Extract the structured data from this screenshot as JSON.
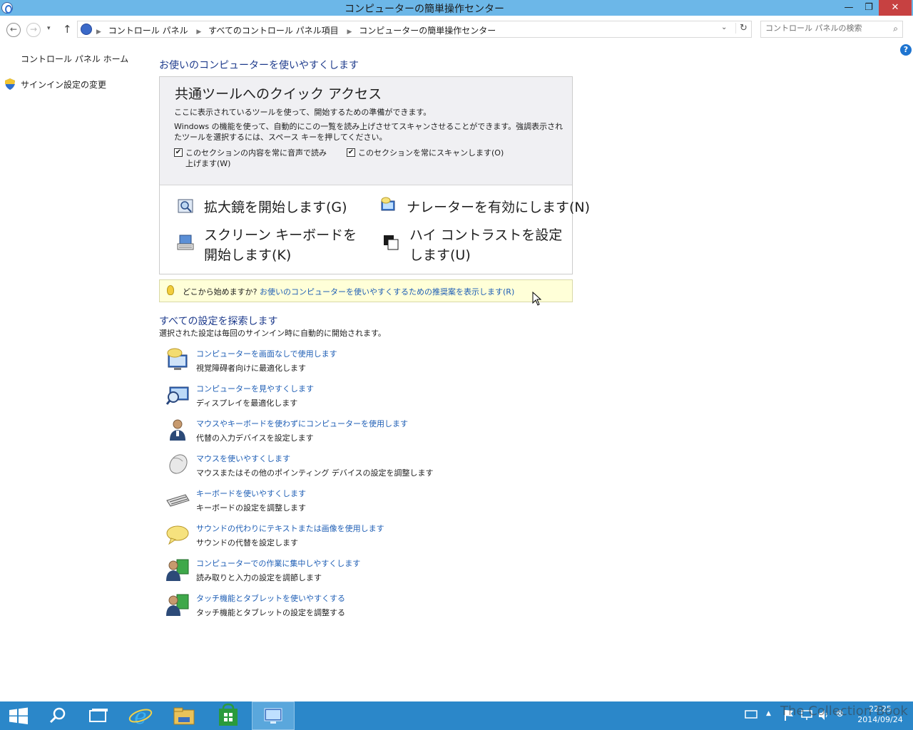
{
  "window": {
    "title": "コンピューターの簡単操作センター",
    "min": "—",
    "max": "❐",
    "close": "✕"
  },
  "nav": {
    "back": "←",
    "forward": "→",
    "dropdown": "▾",
    "up": "↑",
    "breadcrumb": [
      "コントロール パネル",
      "すべてのコントロール パネル項目",
      "コンピューターの簡単操作センター"
    ],
    "refresh": "↻",
    "search_placeholder": "コントロール パネルの検索"
  },
  "sidebar": {
    "home": "コントロール パネル ホーム",
    "signin": "サインイン設定の変更"
  },
  "help": "?",
  "main": {
    "heading": "お使いのコンピューターを使いやすくします",
    "quick": {
      "title": "共通ツールへのクイック アクセス",
      "intro": "ここに表示されているツールを使って、開始するための準備ができます。",
      "desc": "Windows の機能を使って、自動的にこの一覧を読み上げさせてスキャンさせることができます。強調表示されたツールを選択するには、スペース キーを押してください。",
      "check_read": "このセクションの内容を常に音声で読み上げます(W)",
      "check_scan": "このセクションを常にスキャンします(O)",
      "check_mark": "✔",
      "tools": {
        "magnifier": "拡大鏡を開始します(G)",
        "narrator": "ナレーターを有効にします(N)",
        "osk": "スクリーン キーボードを開始します(K)",
        "contrast": "ハイ コントラストを設定します(U)"
      }
    },
    "tip": {
      "prefix": "どこから始めますか?",
      "link": "お使いのコンピューターを使いやすくするための推奨案を表示します(R)"
    },
    "explore_heading": "すべての設定を探索します",
    "explore_sub": "選択された設定は毎回のサインイン時に自動的に開始されます。",
    "settings": [
      {
        "title": "コンピューターを画面なしで使用します",
        "desc": "視覚障碍者向けに最適化します"
      },
      {
        "title": "コンピューターを見やすくします",
        "desc": "ディスプレイを最適化します"
      },
      {
        "title": "マウスやキーボードを使わずにコンピューターを使用します",
        "desc": "代替の入力デバイスを設定します"
      },
      {
        "title": "マウスを使いやすくします",
        "desc": "マウスまたはその他のポインティング デバイスの設定を調整します"
      },
      {
        "title": "キーボードを使いやすくします",
        "desc": "キーボードの設定を調整します"
      },
      {
        "title": "サウンドの代わりにテキストまたは画像を使用します",
        "desc": "サウンドの代替を設定します"
      },
      {
        "title": "コンピューターでの作業に集中しやすくします",
        "desc": "読み取りと入力の設定を調節します"
      },
      {
        "title": "タッチ機能とタブレットを使いやすくする",
        "desc": "タッチ機能とタブレットの設定を調整する"
      }
    ]
  },
  "taskbar": {
    "time": "22:25",
    "date": "2014/09/24",
    "watermark": "The Collection Book"
  },
  "colors": {
    "titlebar": "#6cb7e8",
    "taskbar": "#2b87c9",
    "link": "#1e5eb5",
    "heading": "#1e3b8c"
  }
}
